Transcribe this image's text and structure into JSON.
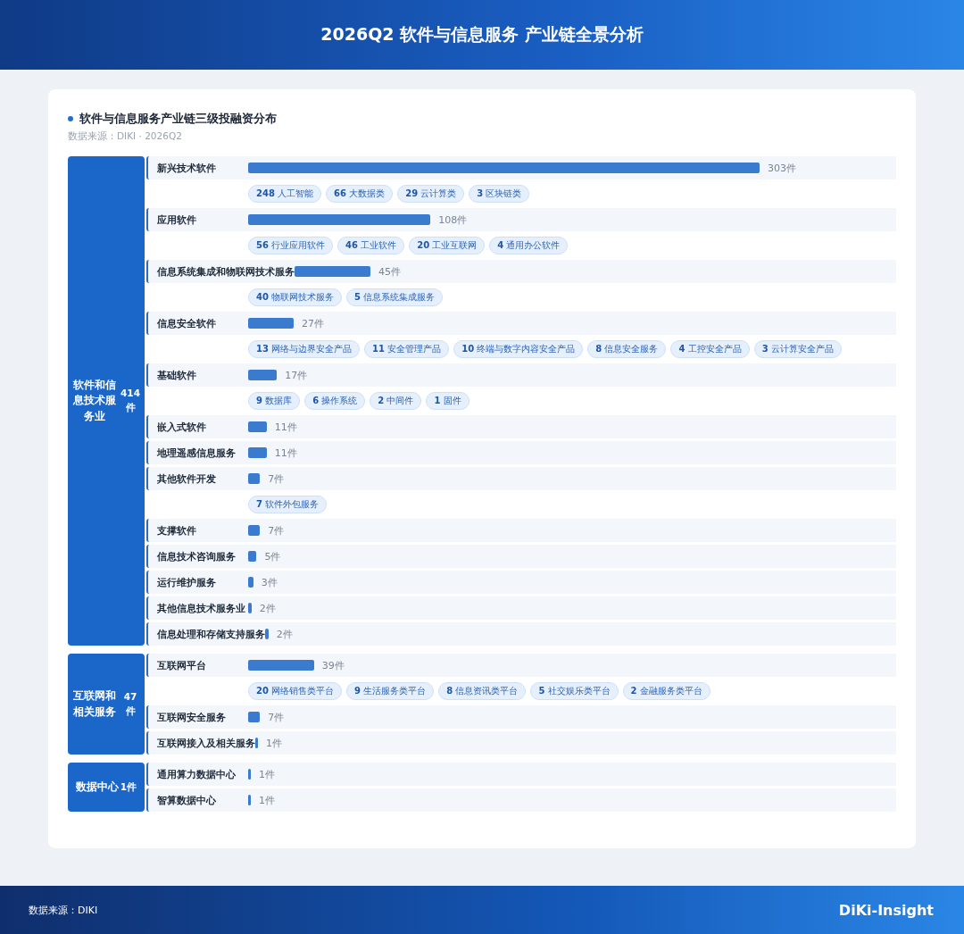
{
  "header": {
    "title": "2026Q2 软件与信息服务 产业链全景分析"
  },
  "card": {
    "title": "软件与信息服务产业链三级投融资分布",
    "source": "数据来源：DIKI · 2026Q2"
  },
  "categories": [
    {
      "name": "软件和信息技术服务业",
      "count": "414件",
      "subs": [
        {
          "name": "新兴技术软件",
          "count": "303件",
          "chips": [
            {
              "num": "248",
              "label": "人工智能"
            },
            {
              "num": "66",
              "label": "大数据类"
            },
            {
              "num": "29",
              "label": "云计算类"
            },
            {
              "num": "3",
              "label": "区块链类"
            }
          ]
        },
        {
          "name": "应用软件",
          "count": "108件",
          "chips": [
            {
              "num": "56",
              "label": "行业应用软件"
            },
            {
              "num": "46",
              "label": "工业软件"
            },
            {
              "num": "20",
              "label": "工业互联网"
            },
            {
              "num": "4",
              "label": "通用办公软件"
            }
          ]
        },
        {
          "name": "信息系统集成和物联网技术服务",
          "count": "45件",
          "chips": [
            {
              "num": "40",
              "label": "物联网技术服务"
            },
            {
              "num": "5",
              "label": "信息系统集成服务"
            }
          ]
        },
        {
          "name": "信息安全软件",
          "count": "27件",
          "chips": [
            {
              "num": "13",
              "label": "网络与边界安全产品"
            },
            {
              "num": "11",
              "label": "安全管理产品"
            },
            {
              "num": "10",
              "label": "终端与数字内容安全产品"
            },
            {
              "num": "8",
              "label": "信息安全服务"
            },
            {
              "num": "4",
              "label": "工控安全产品"
            },
            {
              "num": "3",
              "label": "云计算安全产品"
            }
          ]
        },
        {
          "name": "基础软件",
          "count": "17件",
          "chips": [
            {
              "num": "9",
              "label": "数据库"
            },
            {
              "num": "6",
              "label": "操作系统"
            },
            {
              "num": "2",
              "label": "中间件"
            },
            {
              "num": "1",
              "label": "固件"
            }
          ]
        },
        {
          "name": "嵌入式软件",
          "count": "11件"
        },
        {
          "name": "地理遥感信息服务",
          "count": "11件"
        },
        {
          "name": "其他软件开发",
          "count": "7件",
          "chips": [
            {
              "num": "7",
              "label": "软件外包服务"
            }
          ]
        },
        {
          "name": "支撑软件",
          "count": "7件"
        },
        {
          "name": "信息技术咨询服务",
          "count": "5件"
        },
        {
          "name": "运行维护服务",
          "count": "3件"
        },
        {
          "name": "其他信息技术服务业",
          "count": "2件"
        },
        {
          "name": "信息处理和存储支持服务",
          "count": "2件"
        }
      ]
    },
    {
      "name": "互联网和相关服务",
      "count": "47件",
      "subs": [
        {
          "name": "互联网平台",
          "count": "39件",
          "chips": [
            {
              "num": "20",
              "label": "网络销售类平台"
            },
            {
              "num": "9",
              "label": "生活服务类平台"
            },
            {
              "num": "8",
              "label": "信息资讯类平台"
            },
            {
              "num": "5",
              "label": "社交娱乐类平台"
            },
            {
              "num": "2",
              "label": "金融服务类平台"
            }
          ]
        },
        {
          "name": "互联网安全服务",
          "count": "7件"
        },
        {
          "name": "互联网接入及相关服务",
          "count": "1件"
        }
      ]
    },
    {
      "name": "数据中心",
      "count": "1件",
      "subs": [
        {
          "name": "通用算力数据中心",
          "count": "1件"
        },
        {
          "name": "智算数据中心",
          "count": "1件"
        }
      ]
    }
  ],
  "footer": {
    "source": "数据来源：DIKI",
    "brand": "DiKi-Insight"
  }
}
